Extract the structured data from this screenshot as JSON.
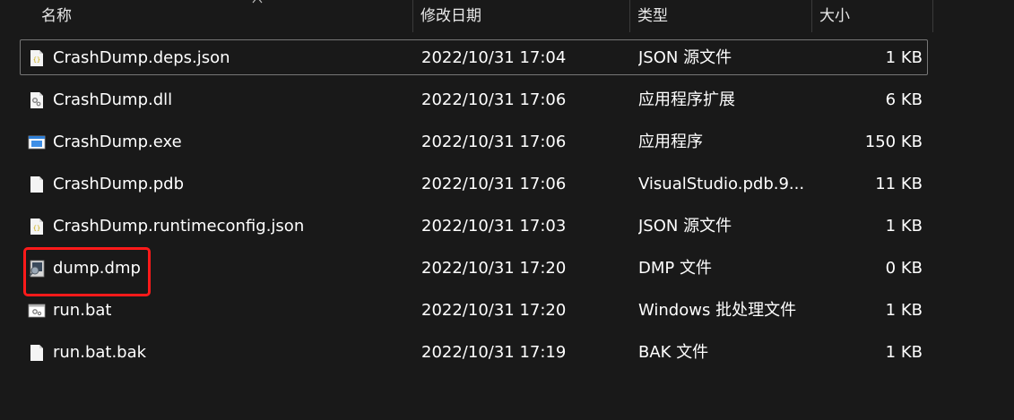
{
  "columns": {
    "name": "名称",
    "date": "修改日期",
    "type": "类型",
    "size": "大小"
  },
  "files": [
    {
      "name": "CrashDump.deps.json",
      "date": "2022/10/31 17:04",
      "type": "JSON 源文件",
      "size": "1 KB",
      "icon": "json-file-icon",
      "selected": true
    },
    {
      "name": "CrashDump.dll",
      "date": "2022/10/31 17:06",
      "type": "应用程序扩展",
      "size": "6 KB",
      "icon": "dll-file-icon",
      "selected": false
    },
    {
      "name": "CrashDump.exe",
      "date": "2022/10/31 17:06",
      "type": "应用程序",
      "size": "150 KB",
      "icon": "exe-file-icon",
      "selected": false
    },
    {
      "name": "CrashDump.pdb",
      "date": "2022/10/31 17:06",
      "type": "VisualStudio.pdb.9...",
      "size": "11 KB",
      "icon": "blank-file-icon",
      "selected": false
    },
    {
      "name": "CrashDump.runtimeconfig.json",
      "date": "2022/10/31 17:03",
      "type": "JSON 源文件",
      "size": "1 KB",
      "icon": "json-file-icon",
      "selected": false
    },
    {
      "name": "dump.dmp",
      "date": "2022/10/31 17:20",
      "type": "DMP 文件",
      "size": "0 KB",
      "icon": "dmp-file-icon",
      "selected": false
    },
    {
      "name": "run.bat",
      "date": "2022/10/31 17:20",
      "type": "Windows 批处理文件",
      "size": "1 KB",
      "icon": "bat-file-icon",
      "selected": false
    },
    {
      "name": "run.bat.bak",
      "date": "2022/10/31 17:19",
      "type": "BAK 文件",
      "size": "1 KB",
      "icon": "blank-file-icon",
      "selected": false
    }
  ],
  "annotation_color": "#ff1a1a"
}
